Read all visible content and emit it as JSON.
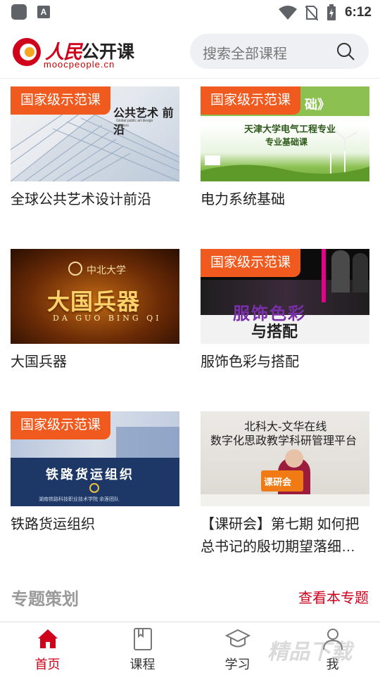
{
  "status_bar": {
    "time": "6:12",
    "app_icon_letter": "A"
  },
  "header": {
    "logo_cn": "人民",
    "logo_cn2": "公开课",
    "logo_url": "moocpeople.cn",
    "search_placeholder": "搜索全部课程"
  },
  "courses": [
    {
      "title": "全球公共艺术设计前沿",
      "badge": "国家级示范课",
      "thumb_text": "公共艺术 前沿",
      "thumb_sub": "Global public art design frontiers"
    },
    {
      "title": "电力系统基础",
      "badge": "国家级示范课",
      "thumb_text": "天津大学电气工程专业",
      "thumb_sub": "专业基础课",
      "thumb_top": "础》"
    },
    {
      "title": "大国兵器",
      "badge": "",
      "thumb_text": "大国兵器",
      "thumb_sub": "DA GUO BING QI",
      "thumb_top": "中北大学"
    },
    {
      "title": "服饰色彩与搭配",
      "badge": "国家级示范课",
      "thumb_text": "服饰色彩",
      "thumb_sub": "与搭配"
    },
    {
      "title": "铁路货运组织",
      "badge": "国家级示范课",
      "thumb_text": "铁路货运组织",
      "thumb_sub": "湖南铁路科技职业技术学院 余莲团队"
    },
    {
      "title": "【课研会】第七期 如何把总书记的殷切期望落细…",
      "badge": "",
      "thumb_text": "北科大-文华在线",
      "thumb_sub": "数字化思政教学科研管理平台",
      "thumb_sign": "课研会"
    }
  ],
  "section": {
    "title": "专题策划",
    "link": "查看本专题"
  },
  "tabs": [
    {
      "label": "首页",
      "icon": "home-icon",
      "active": true
    },
    {
      "label": "课程",
      "icon": "book-icon",
      "active": false
    },
    {
      "label": "学习",
      "icon": "graduation-cap-icon",
      "active": false
    },
    {
      "label": "我",
      "icon": "person-icon",
      "active": false
    }
  ],
  "watermark": "精品下载",
  "colors": {
    "accent": "#d0021b",
    "badge": "#f05a1e"
  }
}
